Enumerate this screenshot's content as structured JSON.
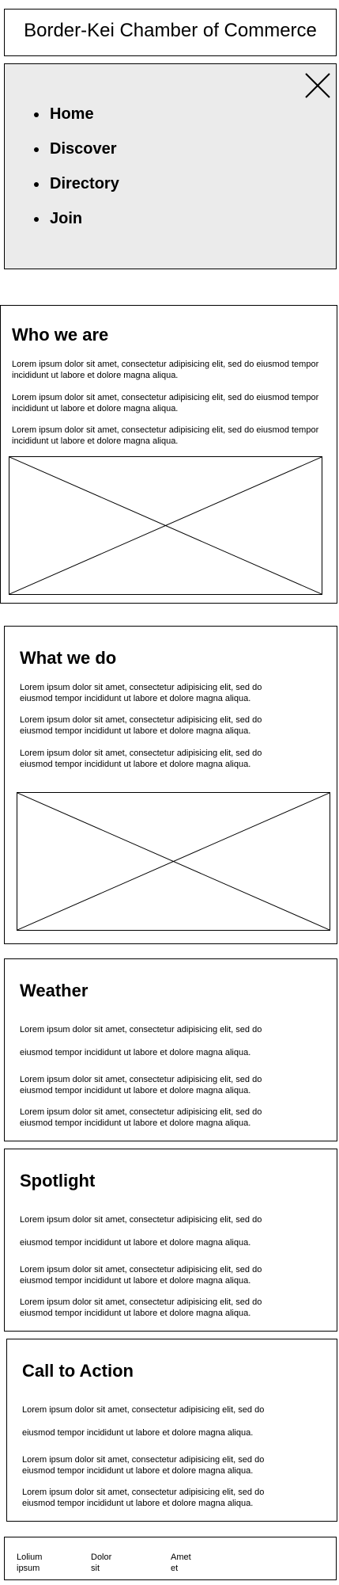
{
  "header": {
    "title": "Border-Kei Chamber of Commerce"
  },
  "nav": {
    "items": [
      "Home",
      "Discover",
      "Directory",
      "Join"
    ]
  },
  "lorem1": "Lorem ipsum dolor sit amet, consectetur adipisicing elit, sed do eiusmod tempor incididunt ut labore et dolore magna aliqua.",
  "lorem_a": "Lorem ipsum dolor sit amet, consectetur adipisicing elit, sed do",
  "lorem_b": "eiusmod tempor incididunt ut labore et dolore magna aliqua.",
  "sections": {
    "who": {
      "title": "Who we are"
    },
    "what": {
      "title": "What we do"
    },
    "weather": {
      "title": "Weather"
    },
    "spotlight": {
      "title": "Spotlight"
    },
    "cta": {
      "title": "Call to Action"
    }
  },
  "footer": {
    "col1": [
      "Lolium",
      "ipsum"
    ],
    "col2": [
      "Dolor",
      "sit"
    ],
    "col3": [
      "Amet",
      "et"
    ]
  }
}
